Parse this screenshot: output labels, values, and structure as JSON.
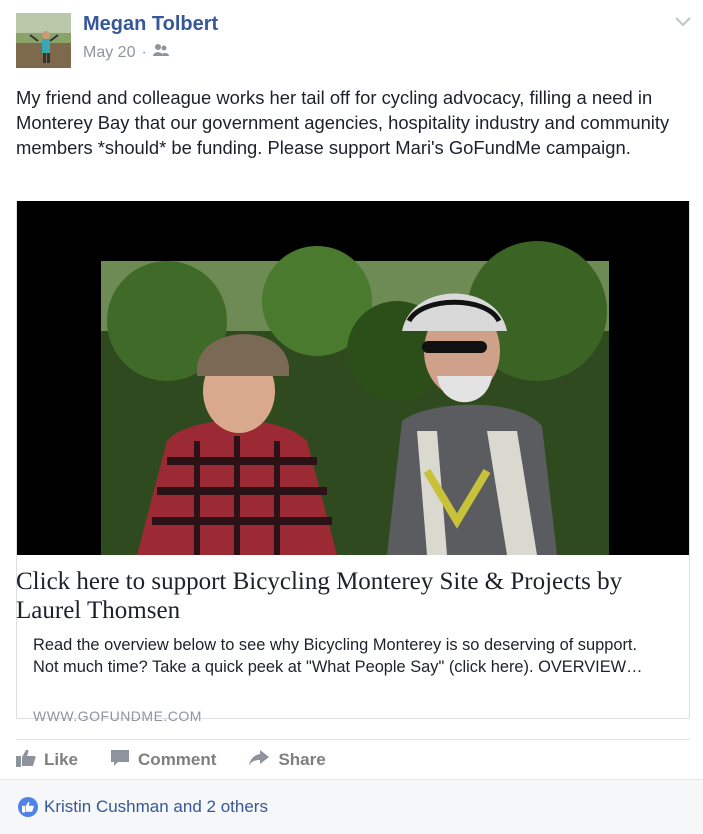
{
  "post": {
    "author": "Megan Tolbert",
    "date": "May 20",
    "separator": "·",
    "audience_icon": "friends-icon",
    "text": "My friend and colleague works her tail off for cycling advocacy, filling a need in Monterey Bay that our government agencies, hospitality industry and community members *should* be funding. Please support Mari's GoFundMe campaign."
  },
  "link": {
    "title": "Click here to support Bicycling Monterey Site & Projects by Laurel Thomsen",
    "description": "Read the overview below to see why Bicycling Monterey is so deserving of support. Not much time? Take a quick peek at \"What People Say\" (click here). OVERVIEW…",
    "domain": "WWW.GOFUNDME.COM"
  },
  "actions": {
    "like": "Like",
    "comment": "Comment",
    "share": "Share"
  },
  "reactions": {
    "text": "Kristin Cushman and 2 others"
  },
  "colors": {
    "name_blue": "#365899",
    "muted": "#90949c",
    "like_blue": "#4f83e8"
  }
}
